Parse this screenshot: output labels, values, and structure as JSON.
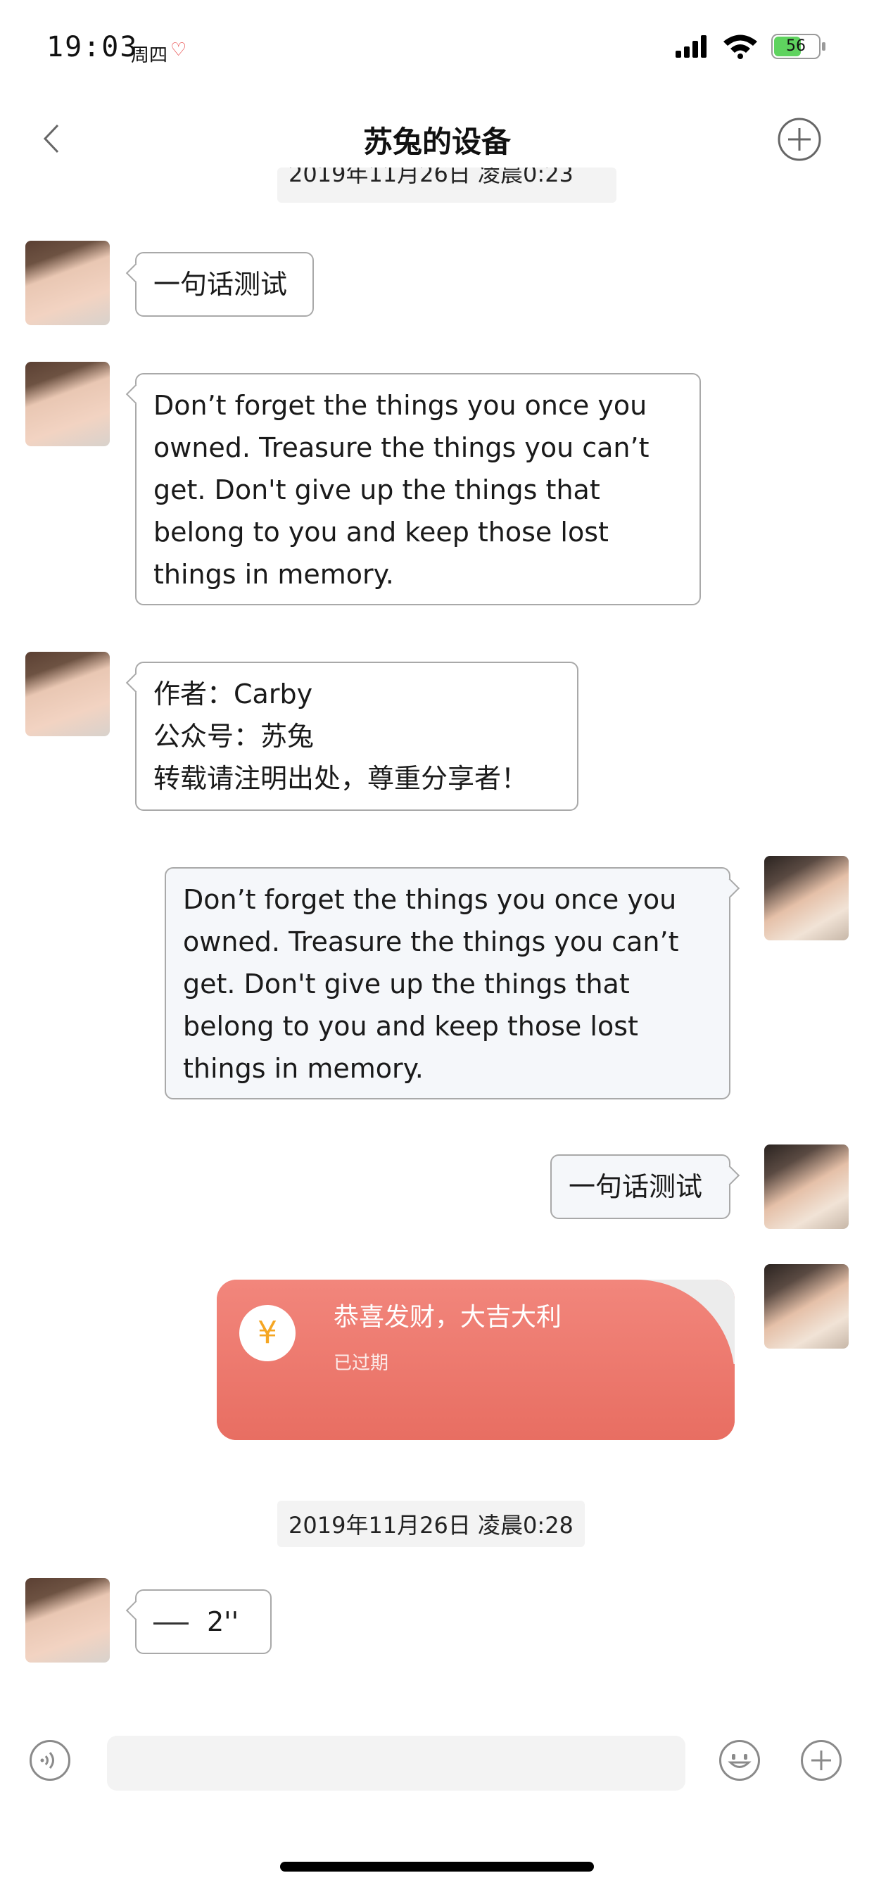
{
  "status_bar": {
    "time": "19:03",
    "day": "周四",
    "heart": "♡",
    "battery": "56"
  },
  "nav": {
    "title": "苏兔的设备"
  },
  "timestamps": {
    "top": "2019年11月26日 凌晨0:23",
    "mid": "2019年11月26日 凌晨0:28"
  },
  "messages": [
    {
      "side": "left",
      "text": "一句话测试"
    },
    {
      "side": "left",
      "text": "Don’t forget the things you once you\nowned. Treasure the things you can’t\nget. Don't give up the things that\nbelong to you and keep those lost\nthings in memory."
    },
    {
      "side": "left",
      "text": "作者：Carby\n公众号：苏兔\n转载请注明出处，尊重分享者！"
    },
    {
      "side": "right",
      "text": "Don’t forget the things you once you\nowned. Treasure the things you can’t\nget. Don't give up the things that\nbelong to you and keep those lost\nthings in memory."
    },
    {
      "side": "right",
      "text": "一句话测试"
    }
  ],
  "red_packet": {
    "icon": "¥",
    "title": "恭喜发财，大吉大利",
    "status": "已过期",
    "color": "#ec7468"
  },
  "voice": {
    "duration": "2''"
  },
  "colors": {
    "bubble_border": "#a9a9a9",
    "my_bubble_bg": "#f5f7fa",
    "timestamp_bg": "#f3f3f3"
  }
}
